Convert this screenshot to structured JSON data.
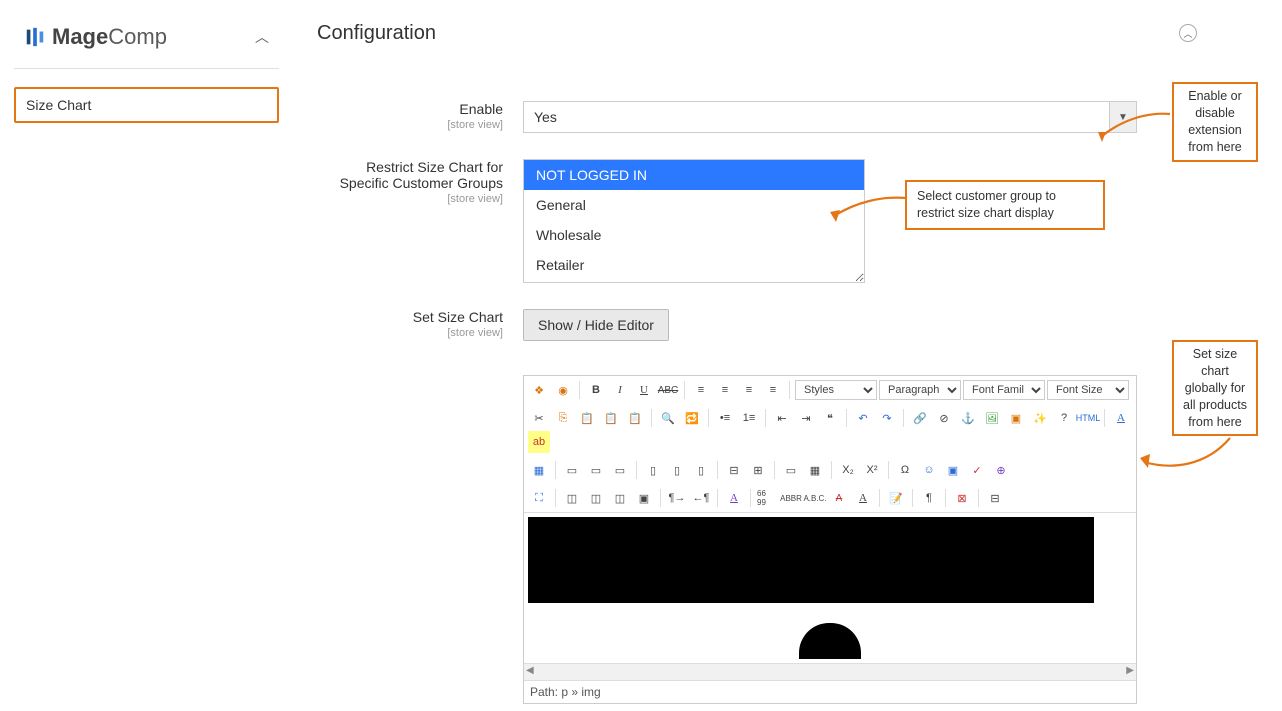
{
  "brand": {
    "prefix": "Mage",
    "suffix": "Comp"
  },
  "sidebar": {
    "item_label": "Size Chart"
  },
  "section_title": "Configuration",
  "fields": {
    "enable": {
      "label": "Enable",
      "scope": "[store view]",
      "value": "Yes"
    },
    "restrict": {
      "label": "Restrict Size Chart for Specific Customer Groups",
      "scope": "[store view]",
      "options": [
        "NOT LOGGED IN",
        "General",
        "Wholesale",
        "Retailer"
      ],
      "selected_index": 0
    },
    "set_chart": {
      "label": "Set Size Chart",
      "scope": "[store view]",
      "toggle_button": "Show / Hide Editor"
    }
  },
  "editor": {
    "styles_label": "Styles",
    "format_label": "Paragraph",
    "font_label": "Font Family",
    "size_label": "Font Size",
    "path": "Path: p » img"
  },
  "annotations": {
    "enable": "Enable or disable extension from here",
    "restrict": "Select customer group to restrict size chart display",
    "set_chart": "Set size chart globally for all products from here"
  }
}
